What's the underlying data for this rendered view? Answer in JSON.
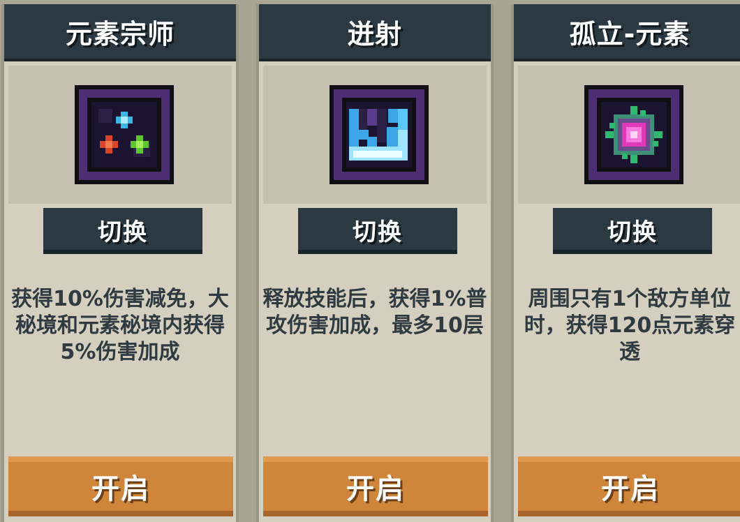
{
  "cards": [
    {
      "title": "元素宗师",
      "icon": "elements-tri-orb-icon",
      "switch_label": "切换",
      "description": "获得10%伤害减免，大秘境和元素秘境内获得5%伤害加成",
      "open_label": "开启"
    },
    {
      "title": "迸射",
      "icon": "ice-burst-icon",
      "switch_label": "切换",
      "description": "释放技能后，获得1%普攻伤害加成，最多10层",
      "open_label": "开启"
    },
    {
      "title": "孤立-元素",
      "icon": "pink-crystal-icon",
      "switch_label": "切换",
      "description": "周围只有1个敌方单位时，获得120点元素穿透",
      "open_label": "开启"
    }
  ],
  "colors": {
    "header_bg": "#2b3942",
    "card_bg": "#d4cfbe",
    "open_button": "#d0863a",
    "text": "#2f3a41"
  }
}
